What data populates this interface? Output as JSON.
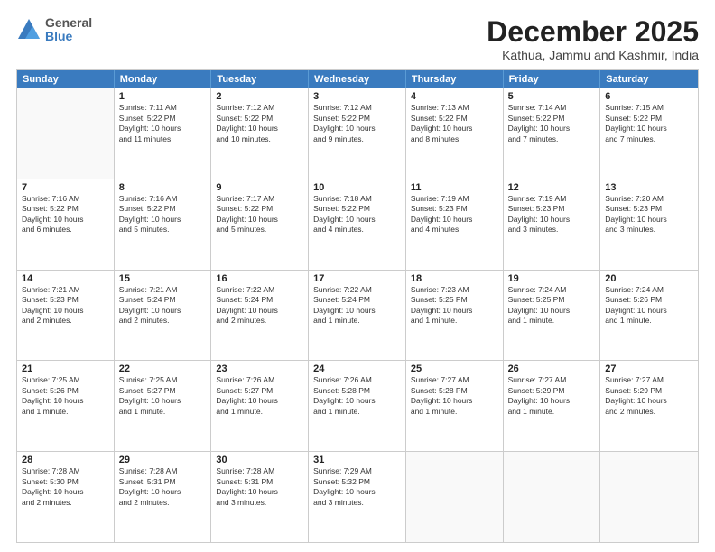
{
  "logo": {
    "line1": "General",
    "line2": "Blue"
  },
  "title": "December 2025",
  "location": "Kathua, Jammu and Kashmir, India",
  "days_of_week": [
    "Sunday",
    "Monday",
    "Tuesday",
    "Wednesday",
    "Thursday",
    "Friday",
    "Saturday"
  ],
  "weeks": [
    [
      {
        "day": "",
        "info": ""
      },
      {
        "day": "1",
        "info": "Sunrise: 7:11 AM\nSunset: 5:22 PM\nDaylight: 10 hours\nand 11 minutes."
      },
      {
        "day": "2",
        "info": "Sunrise: 7:12 AM\nSunset: 5:22 PM\nDaylight: 10 hours\nand 10 minutes."
      },
      {
        "day": "3",
        "info": "Sunrise: 7:12 AM\nSunset: 5:22 PM\nDaylight: 10 hours\nand 9 minutes."
      },
      {
        "day": "4",
        "info": "Sunrise: 7:13 AM\nSunset: 5:22 PM\nDaylight: 10 hours\nand 8 minutes."
      },
      {
        "day": "5",
        "info": "Sunrise: 7:14 AM\nSunset: 5:22 PM\nDaylight: 10 hours\nand 7 minutes."
      },
      {
        "day": "6",
        "info": "Sunrise: 7:15 AM\nSunset: 5:22 PM\nDaylight: 10 hours\nand 7 minutes."
      }
    ],
    [
      {
        "day": "7",
        "info": "Sunrise: 7:16 AM\nSunset: 5:22 PM\nDaylight: 10 hours\nand 6 minutes."
      },
      {
        "day": "8",
        "info": "Sunrise: 7:16 AM\nSunset: 5:22 PM\nDaylight: 10 hours\nand 5 minutes."
      },
      {
        "day": "9",
        "info": "Sunrise: 7:17 AM\nSunset: 5:22 PM\nDaylight: 10 hours\nand 5 minutes."
      },
      {
        "day": "10",
        "info": "Sunrise: 7:18 AM\nSunset: 5:22 PM\nDaylight: 10 hours\nand 4 minutes."
      },
      {
        "day": "11",
        "info": "Sunrise: 7:19 AM\nSunset: 5:23 PM\nDaylight: 10 hours\nand 4 minutes."
      },
      {
        "day": "12",
        "info": "Sunrise: 7:19 AM\nSunset: 5:23 PM\nDaylight: 10 hours\nand 3 minutes."
      },
      {
        "day": "13",
        "info": "Sunrise: 7:20 AM\nSunset: 5:23 PM\nDaylight: 10 hours\nand 3 minutes."
      }
    ],
    [
      {
        "day": "14",
        "info": "Sunrise: 7:21 AM\nSunset: 5:23 PM\nDaylight: 10 hours\nand 2 minutes."
      },
      {
        "day": "15",
        "info": "Sunrise: 7:21 AM\nSunset: 5:24 PM\nDaylight: 10 hours\nand 2 minutes."
      },
      {
        "day": "16",
        "info": "Sunrise: 7:22 AM\nSunset: 5:24 PM\nDaylight: 10 hours\nand 2 minutes."
      },
      {
        "day": "17",
        "info": "Sunrise: 7:22 AM\nSunset: 5:24 PM\nDaylight: 10 hours\nand 1 minute."
      },
      {
        "day": "18",
        "info": "Sunrise: 7:23 AM\nSunset: 5:25 PM\nDaylight: 10 hours\nand 1 minute."
      },
      {
        "day": "19",
        "info": "Sunrise: 7:24 AM\nSunset: 5:25 PM\nDaylight: 10 hours\nand 1 minute."
      },
      {
        "day": "20",
        "info": "Sunrise: 7:24 AM\nSunset: 5:26 PM\nDaylight: 10 hours\nand 1 minute."
      }
    ],
    [
      {
        "day": "21",
        "info": "Sunrise: 7:25 AM\nSunset: 5:26 PM\nDaylight: 10 hours\nand 1 minute."
      },
      {
        "day": "22",
        "info": "Sunrise: 7:25 AM\nSunset: 5:27 PM\nDaylight: 10 hours\nand 1 minute."
      },
      {
        "day": "23",
        "info": "Sunrise: 7:26 AM\nSunset: 5:27 PM\nDaylight: 10 hours\nand 1 minute."
      },
      {
        "day": "24",
        "info": "Sunrise: 7:26 AM\nSunset: 5:28 PM\nDaylight: 10 hours\nand 1 minute."
      },
      {
        "day": "25",
        "info": "Sunrise: 7:27 AM\nSunset: 5:28 PM\nDaylight: 10 hours\nand 1 minute."
      },
      {
        "day": "26",
        "info": "Sunrise: 7:27 AM\nSunset: 5:29 PM\nDaylight: 10 hours\nand 1 minute."
      },
      {
        "day": "27",
        "info": "Sunrise: 7:27 AM\nSunset: 5:29 PM\nDaylight: 10 hours\nand 2 minutes."
      }
    ],
    [
      {
        "day": "28",
        "info": "Sunrise: 7:28 AM\nSunset: 5:30 PM\nDaylight: 10 hours\nand 2 minutes."
      },
      {
        "day": "29",
        "info": "Sunrise: 7:28 AM\nSunset: 5:31 PM\nDaylight: 10 hours\nand 2 minutes."
      },
      {
        "day": "30",
        "info": "Sunrise: 7:28 AM\nSunset: 5:31 PM\nDaylight: 10 hours\nand 3 minutes."
      },
      {
        "day": "31",
        "info": "Sunrise: 7:29 AM\nSunset: 5:32 PM\nDaylight: 10 hours\nand 3 minutes."
      },
      {
        "day": "",
        "info": ""
      },
      {
        "day": "",
        "info": ""
      },
      {
        "day": "",
        "info": ""
      }
    ]
  ]
}
